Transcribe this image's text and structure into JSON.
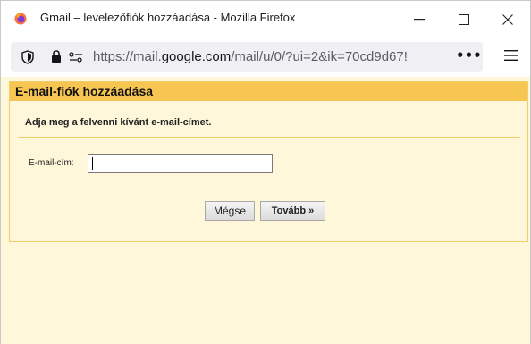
{
  "window": {
    "title": "Gmail – levelezőfiók hozzáadása - Mozilla Firefox",
    "min_glyph": "—",
    "max_glyph": "☐",
    "close_glyph": "✕"
  },
  "urlbar": {
    "url_prefix": "https://mail.",
    "url_host": "google.com",
    "url_path": "/mail/u/0/?ui=2&ik=70cd9d67!",
    "more_glyph": "•••"
  },
  "dialog": {
    "title": "E-mail-fiók hozzáadása",
    "instruction": "Adja meg a felvenni kívánt e-mail-címet.",
    "email_label": "E-mail-cím:",
    "email_value": "",
    "cancel_label": "Mégse",
    "next_label": "Tovább »"
  },
  "colors": {
    "header": "#f7c652",
    "panel_bg": "#fff7d9",
    "panel_border": "#f1cd6a"
  }
}
